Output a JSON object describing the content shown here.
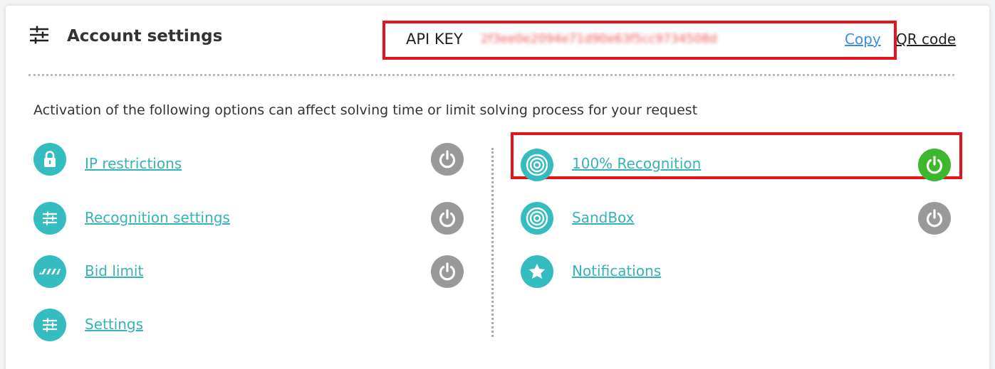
{
  "header": {
    "title": "Account settings",
    "title_icon": "sliders-icon",
    "api_key_label": "API KEY",
    "api_key_value": "2f3ee0e2094e71d90e63f5cc9734508d",
    "copy_label": "Copy",
    "qr_label": "QR code"
  },
  "description": "Activation of the following options can affect solving time or limit solving process for your request",
  "options": {
    "ip": {
      "label": "IP restrictions",
      "icon": "lock-icon",
      "enabled": false
    },
    "recognition": {
      "label": "Recognition settings",
      "icon": "sliders-icon",
      "enabled": false
    },
    "bid": {
      "label": "Bid limit",
      "icon": "bid-limit-icon",
      "enabled": false
    },
    "settings": {
      "label": "Settings",
      "icon": "sliders-icon"
    },
    "full_recognition": {
      "label": "100% Recognition",
      "icon": "target-icon",
      "enabled": true
    },
    "sandbox": {
      "label": "SandBox",
      "icon": "target-icon",
      "enabled": false
    },
    "notifications": {
      "label": "Notifications",
      "icon": "star-icon"
    }
  },
  "colors": {
    "accent": "#35bcbe",
    "toggle_on": "#3db82e",
    "toggle_off": "#999999",
    "highlight": "#e5141b"
  }
}
